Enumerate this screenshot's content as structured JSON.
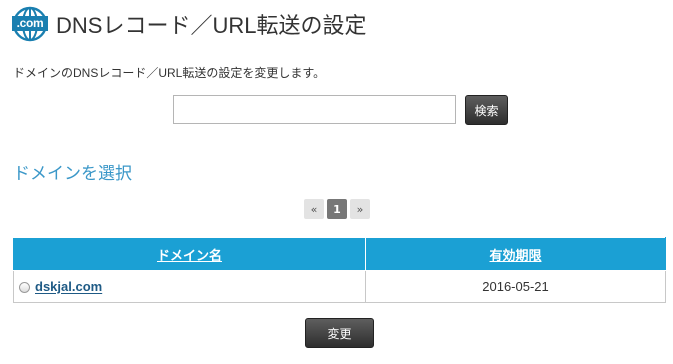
{
  "header": {
    "icon_label": ".com",
    "title": "DNSレコード／URL転送の設定"
  },
  "description": "ドメインのDNSレコード／URL転送の設定を変更します。",
  "search": {
    "value": "",
    "button_label": "検索"
  },
  "section_title": "ドメインを選択",
  "pagination": {
    "prev": "«",
    "current": "1",
    "next": "»"
  },
  "table": {
    "headers": [
      "ドメイン名",
      "有効期限"
    ],
    "rows": [
      {
        "domain": "dskjal.com",
        "expiry": "2016-05-21"
      }
    ]
  },
  "submit_label": "変更",
  "colors": {
    "accent": "#1ba0d4",
    "link": "#1e5a85",
    "section_title": "#3a97c8"
  }
}
